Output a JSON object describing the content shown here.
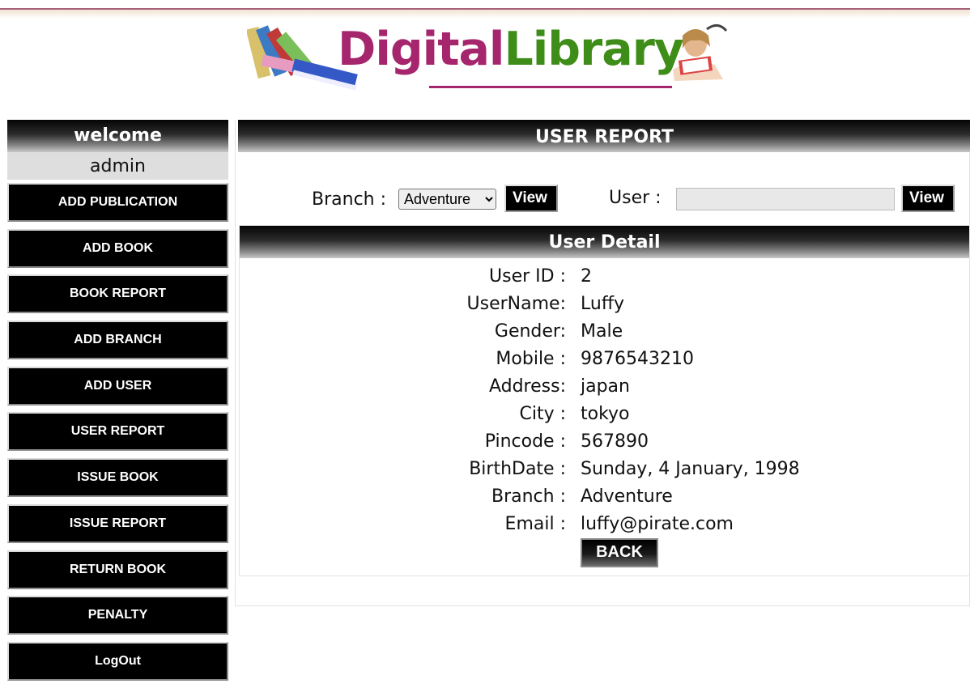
{
  "logo": {
    "text_digital": "Digital",
    "text_library": "Library"
  },
  "sidebar": {
    "welcome": "welcome",
    "user": "admin",
    "items": [
      {
        "label": "ADD PUBLICATION"
      },
      {
        "label": "ADD BOOK"
      },
      {
        "label": "BOOK REPORT"
      },
      {
        "label": "ADD BRANCH"
      },
      {
        "label": "ADD USER"
      },
      {
        "label": "USER REPORT"
      },
      {
        "label": "ISSUE BOOK"
      },
      {
        "label": "ISSUE REPORT"
      },
      {
        "label": "RETURN BOOK"
      },
      {
        "label": "PENALTY"
      },
      {
        "label": "LogOut"
      }
    ]
  },
  "main": {
    "title": "USER REPORT",
    "filter": {
      "branch_label": "Branch :",
      "branch_value": "Adventure",
      "view_label": "View",
      "user_label": "User :",
      "user_value": "",
      "view2_label": "View"
    },
    "detail": {
      "title": "User Detail",
      "fields": [
        {
          "label": "User ID :",
          "value": "2"
        },
        {
          "label": "UserName:",
          "value": "Luffy"
        },
        {
          "label": "Gender:",
          "value": "Male"
        },
        {
          "label": "Mobile :",
          "value": "9876543210"
        },
        {
          "label": "Address:",
          "value": "japan"
        },
        {
          "label": "City :",
          "value": "tokyo"
        },
        {
          "label": "Pincode :",
          "value": "567890"
        },
        {
          "label": "BirthDate :",
          "value": "Sunday, 4 January, 1998"
        },
        {
          "label": "Branch :",
          "value": "Adventure"
        },
        {
          "label": "Email :",
          "value": "luffy@pirate.com"
        }
      ],
      "back_label": "BACK"
    }
  },
  "colors": {
    "logo_magenta": "#a6266e",
    "logo_green": "#3e8d18",
    "button_bg": "#000000"
  }
}
